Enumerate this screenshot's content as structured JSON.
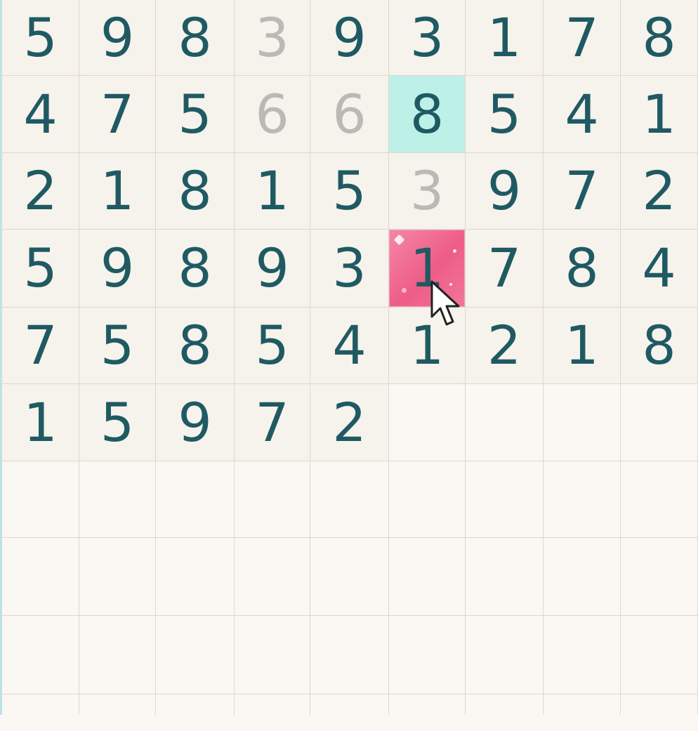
{
  "board": {
    "columns": 9,
    "rows": [
      [
        {
          "v": "5",
          "s": "normal"
        },
        {
          "v": "9",
          "s": "normal"
        },
        {
          "v": "8",
          "s": "normal"
        },
        {
          "v": "3",
          "s": "faded"
        },
        {
          "v": "9",
          "s": "normal"
        },
        {
          "v": "3",
          "s": "normal"
        },
        {
          "v": "1",
          "s": "normal"
        },
        {
          "v": "7",
          "s": "normal"
        },
        {
          "v": "8",
          "s": "normal"
        }
      ],
      [
        {
          "v": "4",
          "s": "normal"
        },
        {
          "v": "7",
          "s": "normal"
        },
        {
          "v": "5",
          "s": "normal"
        },
        {
          "v": "6",
          "s": "faded"
        },
        {
          "v": "6",
          "s": "faded"
        },
        {
          "v": "8",
          "s": "selected"
        },
        {
          "v": "5",
          "s": "normal"
        },
        {
          "v": "4",
          "s": "normal"
        },
        {
          "v": "1",
          "s": "normal"
        }
      ],
      [
        {
          "v": "2",
          "s": "normal"
        },
        {
          "v": "1",
          "s": "normal"
        },
        {
          "v": "8",
          "s": "normal"
        },
        {
          "v": "1",
          "s": "normal"
        },
        {
          "v": "5",
          "s": "normal"
        },
        {
          "v": "3",
          "s": "faded"
        },
        {
          "v": "9",
          "s": "normal"
        },
        {
          "v": "7",
          "s": "normal"
        },
        {
          "v": "2",
          "s": "normal"
        }
      ],
      [
        {
          "v": "5",
          "s": "normal"
        },
        {
          "v": "9",
          "s": "normal"
        },
        {
          "v": "8",
          "s": "normal"
        },
        {
          "v": "9",
          "s": "normal"
        },
        {
          "v": "3",
          "s": "normal"
        },
        {
          "v": "1",
          "s": "hinted"
        },
        {
          "v": "7",
          "s": "normal"
        },
        {
          "v": "8",
          "s": "normal"
        },
        {
          "v": "4",
          "s": "normal"
        }
      ],
      [
        {
          "v": "7",
          "s": "normal"
        },
        {
          "v": "5",
          "s": "normal"
        },
        {
          "v": "8",
          "s": "normal"
        },
        {
          "v": "5",
          "s": "normal"
        },
        {
          "v": "4",
          "s": "normal"
        },
        {
          "v": "1",
          "s": "normal"
        },
        {
          "v": "2",
          "s": "normal"
        },
        {
          "v": "1",
          "s": "normal"
        },
        {
          "v": "8",
          "s": "normal"
        }
      ],
      [
        {
          "v": "1",
          "s": "normal"
        },
        {
          "v": "5",
          "s": "normal"
        },
        {
          "v": "9",
          "s": "normal"
        },
        {
          "v": "7",
          "s": "normal"
        },
        {
          "v": "2",
          "s": "normal"
        },
        {
          "v": "",
          "s": "empty"
        },
        {
          "v": "",
          "s": "empty"
        },
        {
          "v": "",
          "s": "empty"
        },
        {
          "v": "",
          "s": "empty"
        }
      ],
      [
        {
          "v": "",
          "s": "empty"
        },
        {
          "v": "",
          "s": "empty"
        },
        {
          "v": "",
          "s": "empty"
        },
        {
          "v": "",
          "s": "empty"
        },
        {
          "v": "",
          "s": "empty"
        },
        {
          "v": "",
          "s": "empty"
        },
        {
          "v": "",
          "s": "empty"
        },
        {
          "v": "",
          "s": "empty"
        },
        {
          "v": "",
          "s": "empty"
        }
      ],
      [
        {
          "v": "",
          "s": "empty"
        },
        {
          "v": "",
          "s": "empty"
        },
        {
          "v": "",
          "s": "empty"
        },
        {
          "v": "",
          "s": "empty"
        },
        {
          "v": "",
          "s": "empty"
        },
        {
          "v": "",
          "s": "empty"
        },
        {
          "v": "",
          "s": "empty"
        },
        {
          "v": "",
          "s": "empty"
        },
        {
          "v": "",
          "s": "empty"
        }
      ],
      [
        {
          "v": "",
          "s": "empty"
        },
        {
          "v": "",
          "s": "empty"
        },
        {
          "v": "",
          "s": "empty"
        },
        {
          "v": "",
          "s": "empty"
        },
        {
          "v": "",
          "s": "empty"
        },
        {
          "v": "",
          "s": "empty"
        },
        {
          "v": "",
          "s": "empty"
        },
        {
          "v": "",
          "s": "empty"
        },
        {
          "v": "",
          "s": "empty"
        }
      ],
      [
        {
          "v": "",
          "s": "empty"
        },
        {
          "v": "",
          "s": "empty"
        },
        {
          "v": "",
          "s": "empty"
        },
        {
          "v": "",
          "s": "empty"
        },
        {
          "v": "",
          "s": "empty"
        },
        {
          "v": "",
          "s": "empty"
        },
        {
          "v": "",
          "s": "empty"
        },
        {
          "v": "",
          "s": "empty"
        },
        {
          "v": "",
          "s": "empty"
        }
      ]
    ]
  },
  "colors": {
    "digit": "#1f5a63",
    "faded_digit": "#b9b9b5",
    "selected_cell": "#bdf1e8",
    "hinted_cell": "#ee5d87",
    "cell_background": "#f6f2ec",
    "grid_line": "#ddd7cd"
  },
  "cursor": {
    "icon": "mouse-pointer-icon"
  }
}
